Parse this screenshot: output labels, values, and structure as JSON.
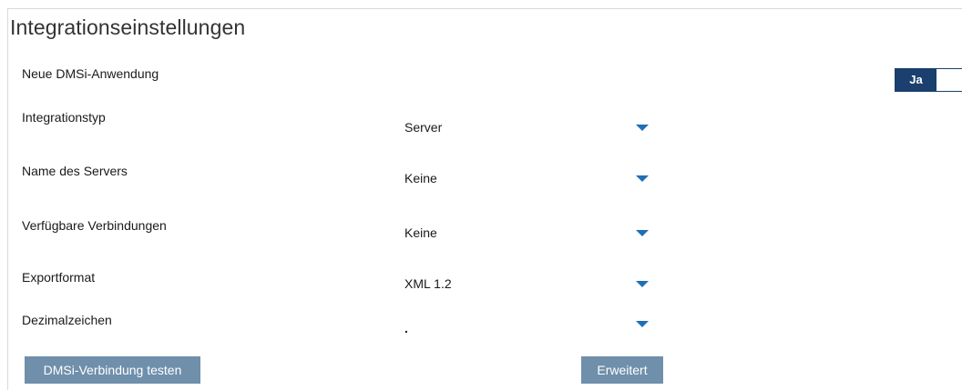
{
  "title": "Integrationseinstellungen",
  "fields": {
    "new_app": {
      "label": "Neue DMSi-Anwendung",
      "toggle_on_label": "Ja"
    },
    "integration_type": {
      "label": "Integrationstyp",
      "value": "Server"
    },
    "server_name": {
      "label": "Name des Servers",
      "value": "Keine"
    },
    "connections": {
      "label": "Verfügbare Verbindungen",
      "value": "Keine"
    },
    "export_format": {
      "label": "Exportformat",
      "value": "XML 1.2"
    },
    "decimal_sign": {
      "label": "Dezimalzeichen",
      "value": "."
    }
  },
  "buttons": {
    "test_connection": "DMSi-Verbindung testen",
    "advanced": "Erweitert"
  },
  "colors": {
    "accent": "#1f6fb5",
    "toggle_bg": "#1b3f6e",
    "button_bg": "#6f8fab"
  },
  "icons": {
    "dropdown": "caret-down-icon"
  }
}
